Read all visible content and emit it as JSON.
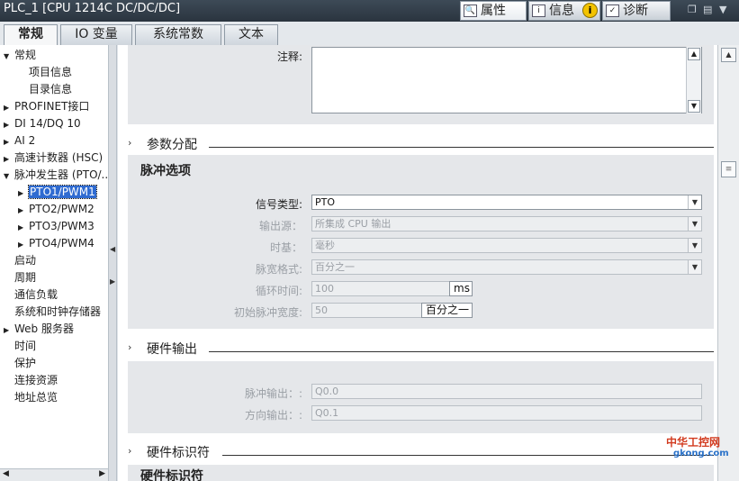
{
  "window": {
    "title": "PLC_1 [CPU 1214C DC/DC/DC]"
  },
  "panel_tabs": [
    {
      "label": "属性",
      "icon": "properties-icon"
    },
    {
      "label": "信息",
      "icon": "info-icon"
    },
    {
      "label": "诊断",
      "icon": "diagnostics-icon"
    }
  ],
  "info_badge": "i",
  "tabs": [
    "常规",
    "IO 变量",
    "系统常数",
    "文本"
  ],
  "nav": {
    "items": [
      {
        "label": "常规",
        "expander": "▼"
      },
      {
        "label": "项目信息",
        "expander": ""
      },
      {
        "label": "目录信息",
        "expander": ""
      },
      {
        "label": "PROFINET接口",
        "expander": "▶"
      },
      {
        "label": "DI 14/DQ 10",
        "expander": "▶"
      },
      {
        "label": "AI 2",
        "expander": "▶"
      },
      {
        "label": "高速计数器 (HSC)",
        "expander": "▶"
      },
      {
        "label": "脉冲发生器 (PTO/...",
        "expander": "▼"
      },
      {
        "label": "PTO1/PWM1",
        "expander": "▶"
      },
      {
        "label": "PTO2/PWM2",
        "expander": "▶"
      },
      {
        "label": "PTO3/PWM3",
        "expander": "▶"
      },
      {
        "label": "PTO4/PWM4",
        "expander": "▶"
      },
      {
        "label": "启动",
        "expander": ""
      },
      {
        "label": "周期",
        "expander": ""
      },
      {
        "label": "通信负载",
        "expander": ""
      },
      {
        "label": "系统和时钟存储器",
        "expander": ""
      },
      {
        "label": "Web 服务器",
        "expander": "▶"
      },
      {
        "label": "时间",
        "expander": ""
      },
      {
        "label": "保护",
        "expander": ""
      },
      {
        "label": "连接资源",
        "expander": ""
      },
      {
        "label": "地址总览",
        "expander": ""
      }
    ]
  },
  "content": {
    "comment_label": "注释:",
    "sections": {
      "param_assign": "参数分配",
      "hw_output": "硬件输出",
      "hw_id": "硬件标识符"
    },
    "pulse_options_title": "脉冲选项",
    "fields": {
      "signal_type": {
        "label": "信号类型:",
        "value": "PTO"
      },
      "output_source": {
        "label": "输出源：",
        "value": "所集成 CPU 输出"
      },
      "time_base": {
        "label": "时基：",
        "value": "毫秒"
      },
      "pulse_width_format": {
        "label": "脉宽格式:",
        "value": "百分之一"
      },
      "cycle_time": {
        "label": "循环时间:",
        "value": "100",
        "unit": "ms"
      },
      "initial_pulse_width": {
        "label": "初始脉冲宽度:",
        "value": "50",
        "unit": "百分之一"
      },
      "pulse_output": {
        "label": "脉冲输出：:",
        "value": "Q0.0"
      },
      "direction_output": {
        "label": "方向输出：:",
        "value": "Q0.1"
      }
    },
    "hw_id_title": "硬件标识符"
  },
  "watermark": {
    "line1": "中华工控网",
    "line2": "gkong.com"
  }
}
